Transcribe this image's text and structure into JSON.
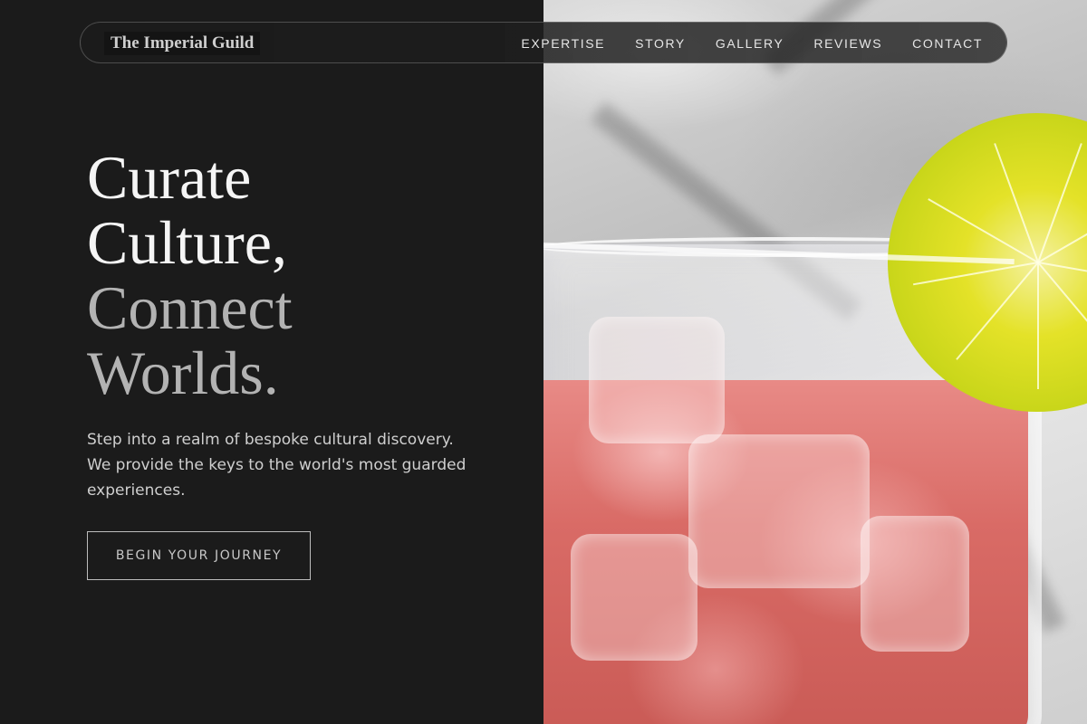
{
  "nav": {
    "brand": "The Imperial Guild",
    "links": [
      {
        "label": "EXPERTISE"
      },
      {
        "label": "STORY"
      },
      {
        "label": "GALLERY"
      },
      {
        "label": "REVIEWS"
      },
      {
        "label": "CONTACT"
      }
    ]
  },
  "hero": {
    "title_lines": [
      "Curate",
      "Culture,",
      "Connect",
      "Worlds."
    ],
    "description": "Step into a realm of bespoke cultural discovery. We provide the keys to the world's most guarded experiences.",
    "cta_label": "BEGIN YOUR JOURNEY"
  },
  "colors": {
    "background": "#1b1b1b",
    "heading_light": "#f5f5f5",
    "heading_muted": "#b3b3b3"
  }
}
